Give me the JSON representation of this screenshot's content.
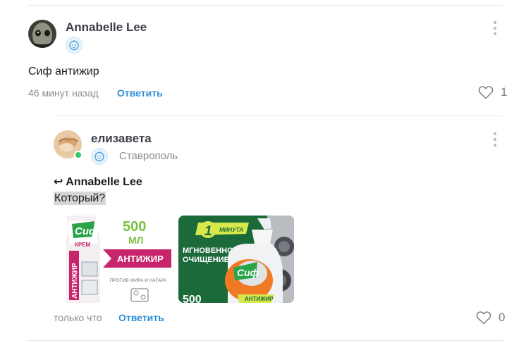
{
  "comment": {
    "author": "Annabelle Lee",
    "text": "Сиф антижир",
    "time": "46 минут назад",
    "reply_label": "Ответить",
    "likes": "1"
  },
  "reply": {
    "author": "елизавета",
    "city": "Ставрополь",
    "quoted_author": "↩ Annabelle Lee",
    "text": "Который?",
    "time": "только что",
    "reply_label": "Ответить",
    "likes": "0",
    "images": [
      {
        "brand": "Сиф",
        "kind": "КРЕМ",
        "side": "АНТИЖИР",
        "volume": "500",
        "unit": "МЛ",
        "banner": "АНТИЖИР",
        "subtitle": "ПРОТИВ ЖИРА И НАГАРА"
      },
      {
        "badge_num": "1",
        "badge_unit": "МИНУТА",
        "line1": "МГНОВЕННОЕ",
        "line2": "ОЧИЩЕНИЕ",
        "brand": "Сиф",
        "volume": "500",
        "label": "АНТИЖИР"
      }
    ]
  },
  "colors": {
    "accent": "#2d8fd8",
    "online": "#38c56b",
    "cif_pink": "#c8246c",
    "cif_green": "#1c6a3a"
  }
}
